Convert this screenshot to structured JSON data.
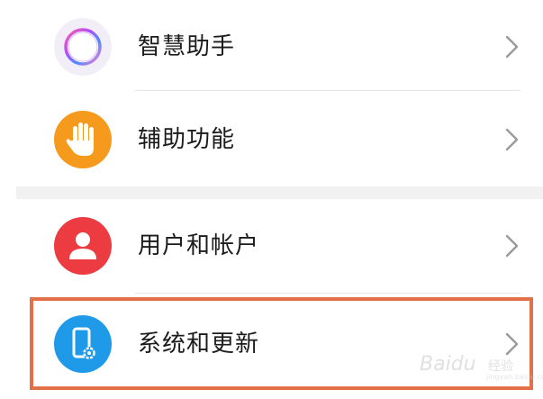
{
  "settings_list": {
    "items": [
      {
        "label": "智慧助手",
        "icon": "circle-ring-icon"
      },
      {
        "label": "辅助功能",
        "icon": "hand-icon",
        "icon_color": "#f59a1c"
      },
      {
        "label": "用户和帐户",
        "icon": "user-icon",
        "icon_color": "#ec3b41"
      },
      {
        "label": "系统和更新",
        "icon": "phone-gear-icon",
        "icon_color": "#1f9ae8"
      }
    ]
  },
  "highlight": {
    "target": "系统和更新",
    "color": "#e2714a"
  },
  "watermark": {
    "brand": "Baidu",
    "sub": "经验",
    "url": "jingyan.baidu.com"
  }
}
